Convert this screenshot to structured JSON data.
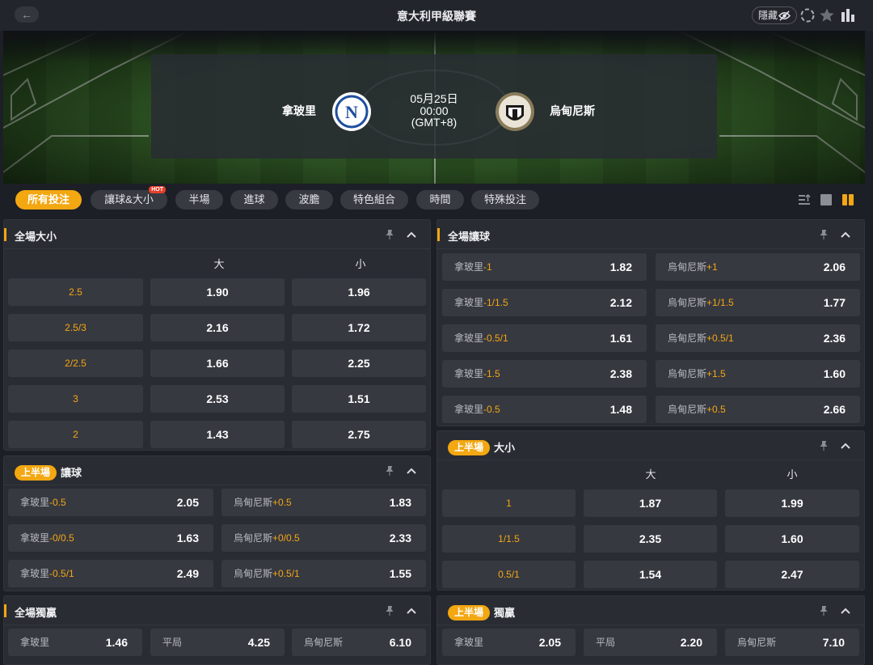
{
  "header": {
    "back_icon": "arrow-left-icon",
    "title": "意大利甲級聯賽",
    "hide_label": "隱藏"
  },
  "match": {
    "home_team": "拿玻里",
    "away_team": "烏甸尼斯",
    "date": "05月25日",
    "time": "00:00",
    "timezone": "(GMT+8)",
    "home_logo_letter": "N"
  },
  "tabs": [
    {
      "label": "所有投注",
      "active": true
    },
    {
      "label": "讓球&大小",
      "badge": "HOT"
    },
    {
      "label": "半場"
    },
    {
      "label": "進球"
    },
    {
      "label": "波膽"
    },
    {
      "label": "特色組合"
    },
    {
      "label": "時間"
    },
    {
      "label": "特殊投注"
    }
  ],
  "colors": {
    "accent": "#f3a711",
    "background": "#1d1f26",
    "panel": "#2a2c33",
    "cell": "#373941",
    "hot": "#e4402c"
  },
  "panels": {
    "fulltime_ou": {
      "title": "全場大小",
      "col_over": "大",
      "col_under": "小",
      "rows": [
        {
          "line": "2.5",
          "over": "1.90",
          "under": "1.96"
        },
        {
          "line": "2.5/3",
          "over": "2.16",
          "under": "1.72"
        },
        {
          "line": "2/2.5",
          "over": "1.66",
          "under": "2.25"
        },
        {
          "line": "3",
          "over": "2.53",
          "under": "1.51"
        },
        {
          "line": "2",
          "over": "1.43",
          "under": "2.75"
        }
      ]
    },
    "fulltime_hdp": {
      "title": "全場讓球",
      "rows": [
        {
          "home": "拿玻里",
          "home_hdp": "-1",
          "home_odds": "1.82",
          "away": "烏甸尼斯",
          "away_hdp": "+1",
          "away_odds": "2.06"
        },
        {
          "home": "拿玻里",
          "home_hdp": "-1/1.5",
          "home_odds": "2.12",
          "away": "烏甸尼斯",
          "away_hdp": "+1/1.5",
          "away_odds": "1.77"
        },
        {
          "home": "拿玻里",
          "home_hdp": "-0.5/1",
          "home_odds": "1.61",
          "away": "烏甸尼斯",
          "away_hdp": "+0.5/1",
          "away_odds": "2.36"
        },
        {
          "home": "拿玻里",
          "home_hdp": "-1.5",
          "home_odds": "2.38",
          "away": "烏甸尼斯",
          "away_hdp": "+1.5",
          "away_odds": "1.60"
        },
        {
          "home": "拿玻里",
          "home_hdp": "-0.5",
          "home_odds": "1.48",
          "away": "烏甸尼斯",
          "away_hdp": "+0.5",
          "away_odds": "2.66"
        }
      ]
    },
    "firsthalf_hdp": {
      "badge": "上半場",
      "title": "讓球",
      "rows": [
        {
          "home": "拿玻里",
          "home_hdp": "-0.5",
          "home_odds": "2.05",
          "away": "烏甸尼斯",
          "away_hdp": "+0.5",
          "away_odds": "1.83"
        },
        {
          "home": "拿玻里",
          "home_hdp": "-0/0.5",
          "home_odds": "1.63",
          "away": "烏甸尼斯",
          "away_hdp": "+0/0.5",
          "away_odds": "2.33"
        },
        {
          "home": "拿玻里",
          "home_hdp": "-0.5/1",
          "home_odds": "2.49",
          "away": "烏甸尼斯",
          "away_hdp": "+0.5/1",
          "away_odds": "1.55"
        }
      ]
    },
    "firsthalf_ou": {
      "badge": "上半場",
      "title": "大小",
      "col_over": "大",
      "col_under": "小",
      "rows": [
        {
          "line": "1",
          "over": "1.87",
          "under": "1.99"
        },
        {
          "line": "1/1.5",
          "over": "2.35",
          "under": "1.60"
        },
        {
          "line": "0.5/1",
          "over": "1.54",
          "under": "2.47"
        }
      ]
    },
    "fulltime_1x2": {
      "title": "全場獨贏",
      "home": "拿玻里",
      "home_odds": "1.46",
      "draw": "平局",
      "draw_odds": "4.25",
      "away": "烏甸尼斯",
      "away_odds": "6.10"
    },
    "firsthalf_1x2": {
      "badge": "上半場",
      "title": "獨贏",
      "home": "拿玻里",
      "home_odds": "2.05",
      "draw": "平局",
      "draw_odds": "2.20",
      "away": "烏甸尼斯",
      "away_odds": "7.10"
    }
  }
}
